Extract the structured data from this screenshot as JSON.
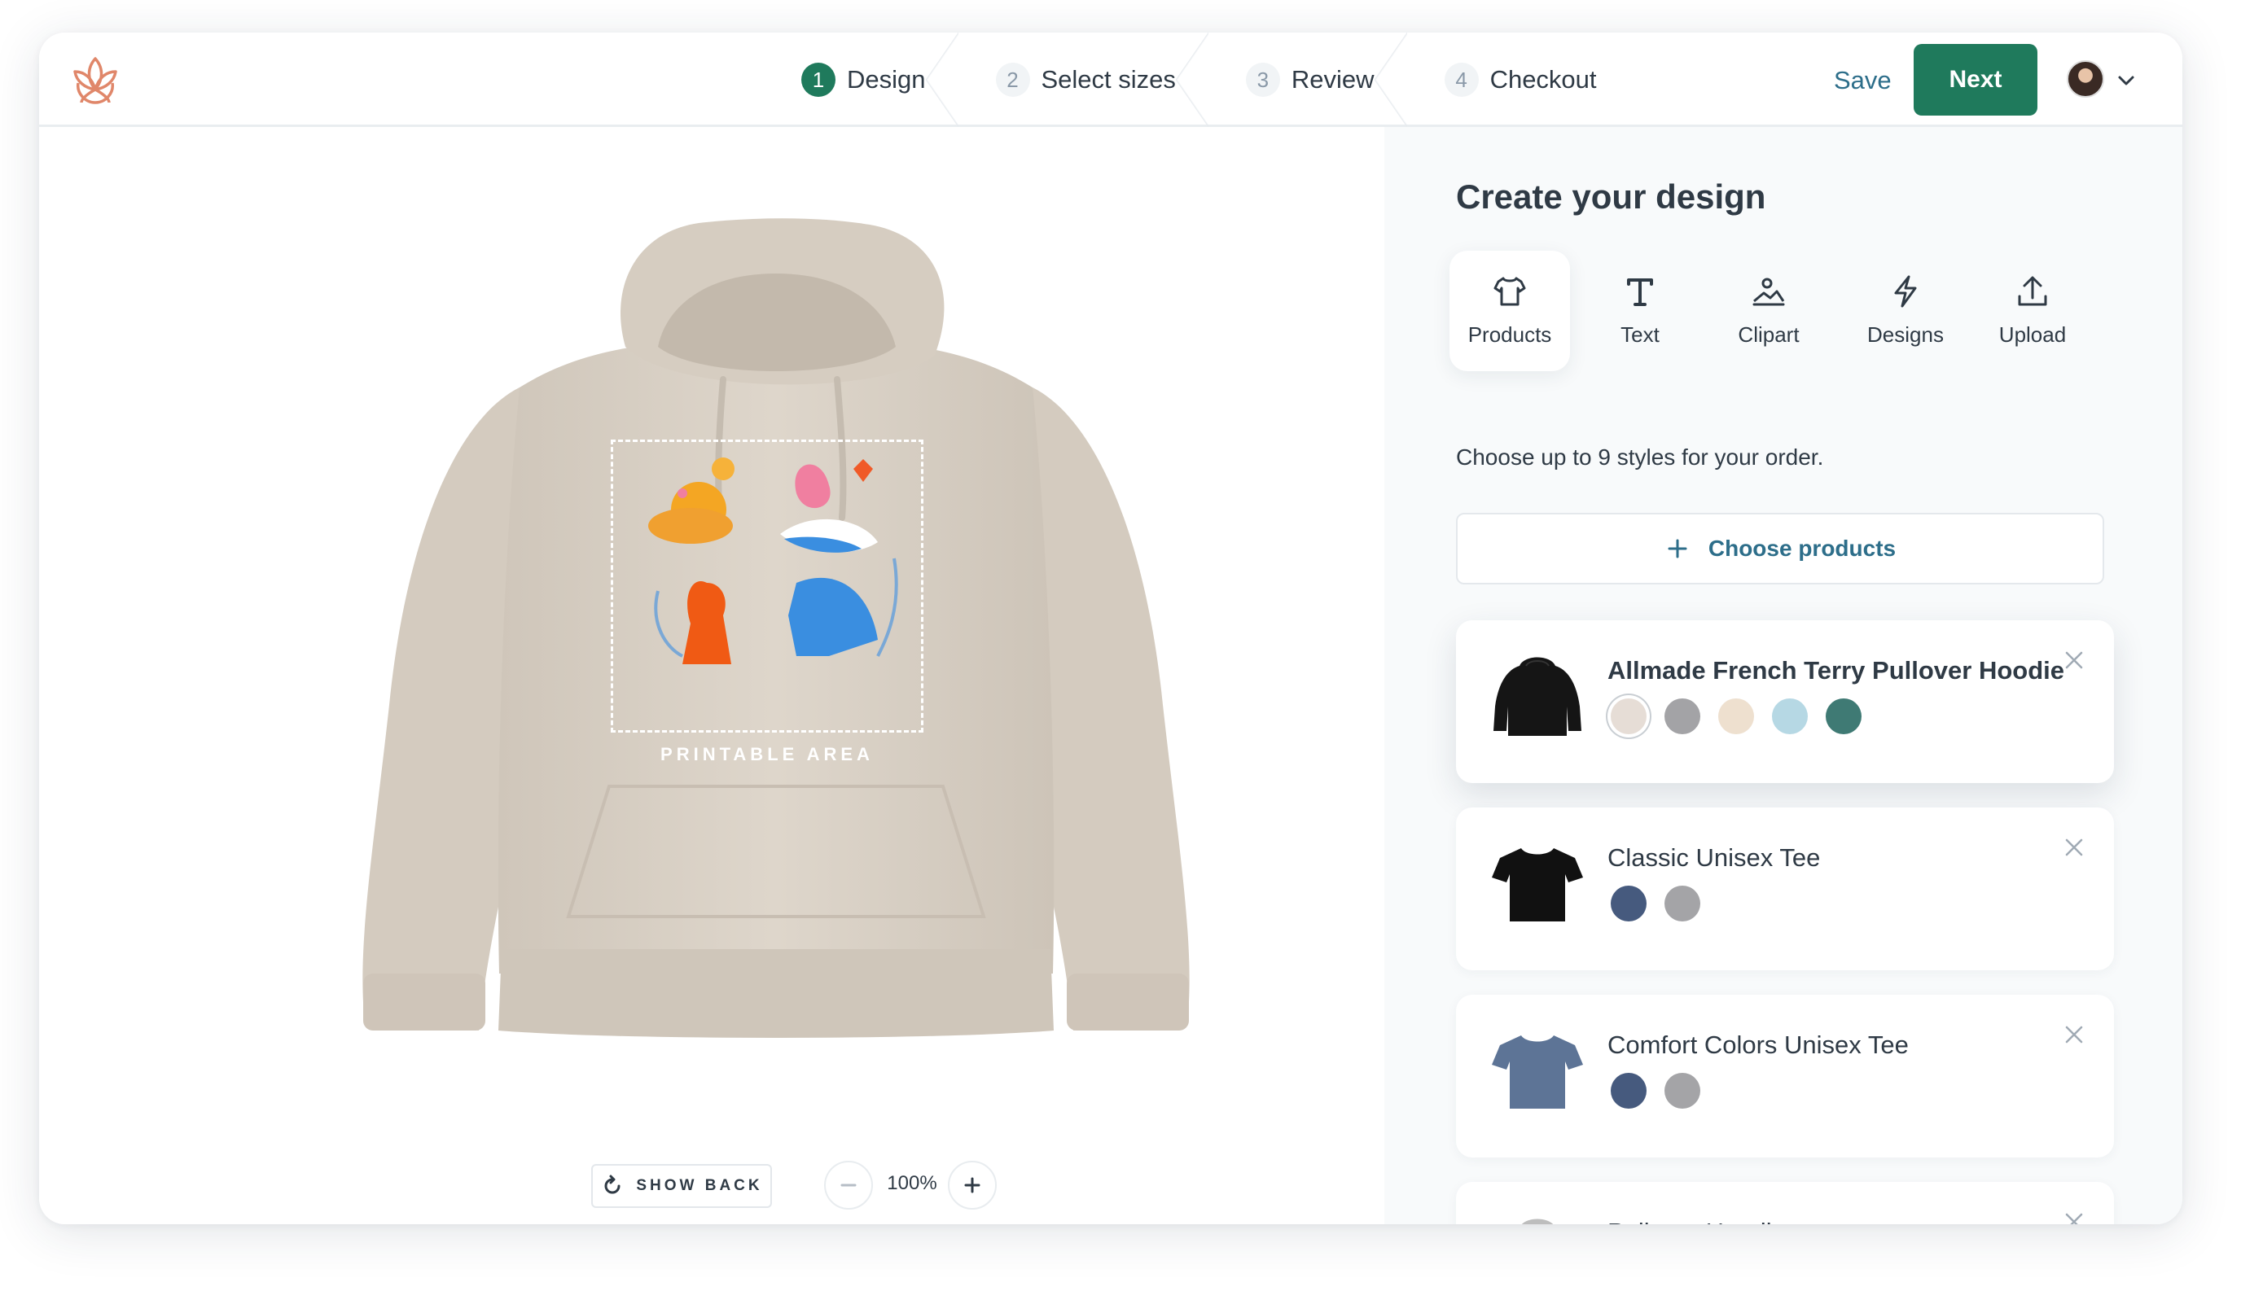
{
  "header": {
    "steps": [
      {
        "num": "1",
        "label": "Design"
      },
      {
        "num": "2",
        "label": "Select sizes"
      },
      {
        "num": "3",
        "label": "Review"
      },
      {
        "num": "4",
        "label": "Checkout"
      }
    ],
    "save_label": "Save",
    "next_label": "Next"
  },
  "canvas": {
    "print_area_label": "PRINTABLE AREA",
    "show_back_label": "SHOW BACK",
    "zoom_level": "100%",
    "garment_color": "#d9d0c4"
  },
  "panel": {
    "title": "Create your design",
    "tools": [
      {
        "label": "Products",
        "icon": "tshirt-icon"
      },
      {
        "label": "Text",
        "icon": "text-icon"
      },
      {
        "label": "Clipart",
        "icon": "clipart-icon"
      },
      {
        "label": "Designs",
        "icon": "lightning-icon"
      },
      {
        "label": "Upload",
        "icon": "upload-icon"
      }
    ],
    "instructions": "Choose up to 9 styles for your order.",
    "choose_products_label": "Choose products",
    "products": [
      {
        "name": "Allmade French Terry Pullover Hoodie",
        "colors": [
          "#e6ddd6",
          "#a3a3a6",
          "#eee0cf",
          "#b6d8e4",
          "#3f7a74"
        ]
      },
      {
        "name": "Classic Unisex Tee",
        "colors": [
          "#465a7e",
          "#a4a4a7"
        ]
      },
      {
        "name": "Comfort Colors Unisex Tee",
        "colors": [
          "#465a7e",
          "#a4a4a7"
        ]
      },
      {
        "name": "Pullover Hoodie",
        "colors": []
      }
    ]
  },
  "colors": {
    "accent": "#1f7a5c",
    "link": "#2d6e8a",
    "logo": "#e0876a"
  }
}
